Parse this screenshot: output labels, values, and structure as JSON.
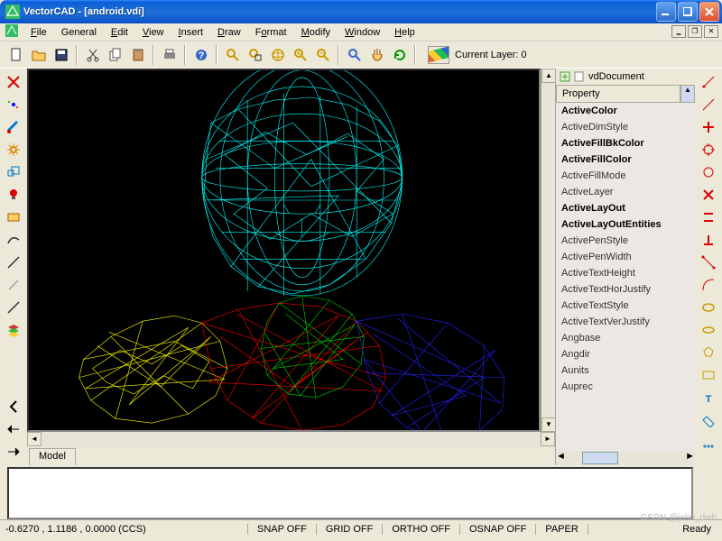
{
  "window": {
    "title": "VectorCAD - [android.vdi]"
  },
  "menu": [
    "File",
    "General",
    "Edit",
    "View",
    "Insert",
    "Draw",
    "Format",
    "Modify",
    "Window",
    "Help"
  ],
  "toolbar": {
    "layer_label": "Current Layer: 0"
  },
  "properties": {
    "root": "vdDocument",
    "header": "Property",
    "items": [
      {
        "label": "ActiveColor",
        "bold": true
      },
      {
        "label": "ActiveDimStyle",
        "bold": false
      },
      {
        "label": "ActiveFillBkColor",
        "bold": true
      },
      {
        "label": "ActiveFillColor",
        "bold": true
      },
      {
        "label": "ActiveFillMode",
        "bold": false
      },
      {
        "label": "ActiveLayer",
        "bold": false
      },
      {
        "label": "ActiveLayOut",
        "bold": true
      },
      {
        "label": "ActiveLayOutEntities",
        "bold": true
      },
      {
        "label": "ActivePenStyle",
        "bold": false
      },
      {
        "label": "ActivePenWidth",
        "bold": false
      },
      {
        "label": "ActiveTextHeight",
        "bold": false
      },
      {
        "label": "ActiveTextHorJustify",
        "bold": false
      },
      {
        "label": "ActiveTextStyle",
        "bold": false
      },
      {
        "label": "ActiveTextVerJustify",
        "bold": false
      },
      {
        "label": "Angbase",
        "bold": false
      },
      {
        "label": "Angdir",
        "bold": false
      },
      {
        "label": "Aunits",
        "bold": false
      },
      {
        "label": "Auprec",
        "bold": false
      }
    ]
  },
  "tabs": {
    "model": "Model"
  },
  "status": {
    "coord": "-0.6270 , 1.1186 , 0.0000 (CCS)",
    "snap": "SNAP OFF",
    "grid": "GRID OFF",
    "ortho": "ORTHO OFF",
    "osnap": "OSNAP OFF",
    "paper": "PAPER",
    "ready": "Ready"
  },
  "watermark": "CSDN @john_dwh"
}
